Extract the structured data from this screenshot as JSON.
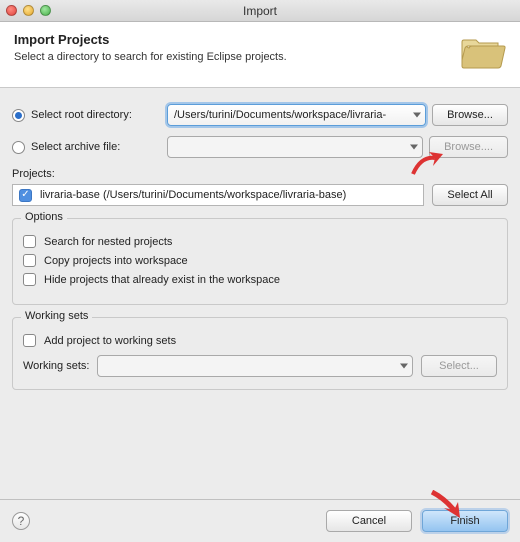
{
  "window": {
    "title": "Import"
  },
  "header": {
    "title": "Import Projects",
    "subtitle": "Select a directory to search for existing Eclipse projects."
  },
  "source": {
    "rootLabel": "Select root directory:",
    "rootValue": "/Users/turini/Documents/workspace/livraria-",
    "rootBrowse": "Browse...",
    "archiveLabel": "Select archive file:",
    "archiveValue": "",
    "archiveBrowse": "Browse...."
  },
  "projects": {
    "label": "Projects:",
    "items": [
      {
        "checked": true,
        "text": "livraria-base (/Users/turini/Documents/workspace/livraria-base)"
      }
    ],
    "selectAll": "Select All"
  },
  "options": {
    "title": "Options",
    "nested": "Search for nested projects",
    "copy": "Copy projects into workspace",
    "hide": "Hide projects that already exist in the workspace"
  },
  "workingSets": {
    "title": "Working sets",
    "add": "Add project to working sets",
    "label": "Working sets:",
    "value": "",
    "select": "Select..."
  },
  "footer": {
    "cancel": "Cancel",
    "finish": "Finish"
  }
}
